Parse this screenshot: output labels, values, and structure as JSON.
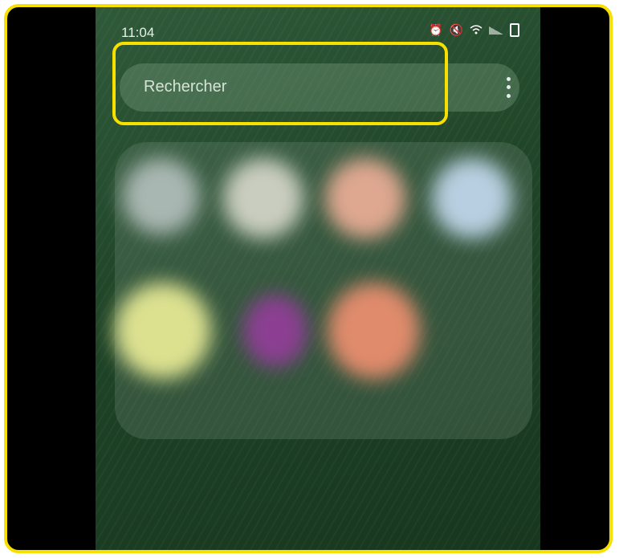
{
  "status_bar": {
    "time": "11:04",
    "icons": [
      "alarm-icon",
      "mute-icon",
      "wifi-icon",
      "signal-icon",
      "battery-icon"
    ]
  },
  "search": {
    "placeholder": "Rechercher",
    "more_icon": "more-vertical-icon"
  },
  "highlight_color": "#f7df00",
  "app_icons": [
    {
      "name": "app-icon-1",
      "color": "#a9b7b2"
    },
    {
      "name": "app-icon-2",
      "color": "#c9cdbf"
    },
    {
      "name": "app-icon-3",
      "color": "#dea790"
    },
    {
      "name": "app-icon-4",
      "color": "#b7cfe0"
    },
    {
      "name": "app-icon-5",
      "color": "#dce190"
    },
    {
      "name": "app-icon-6",
      "color": "#8c3f92"
    },
    {
      "name": "app-icon-7",
      "color": "#e08b6c"
    }
  ]
}
